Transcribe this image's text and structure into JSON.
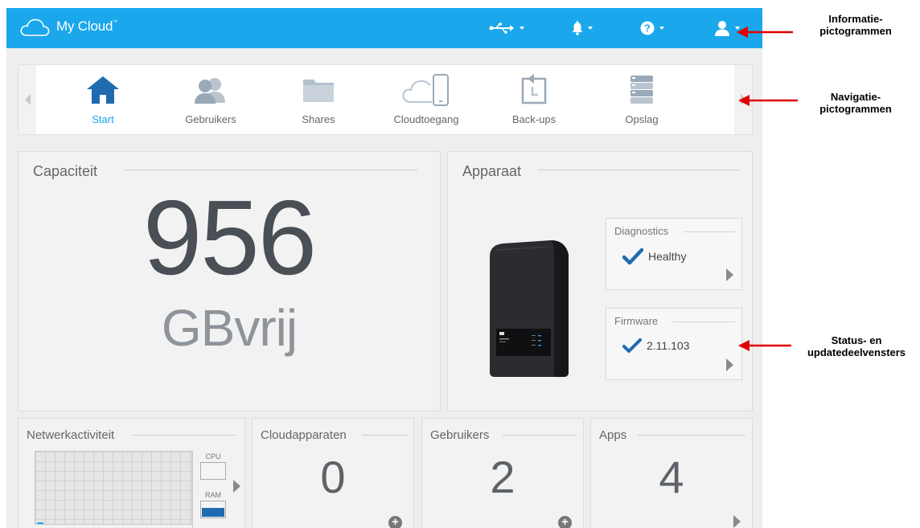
{
  "app": {
    "title": "My Cloud",
    "trademark": "™"
  },
  "topbar_icons": [
    {
      "name": "usb-icon"
    },
    {
      "name": "bell-icon"
    },
    {
      "name": "help-icon"
    },
    {
      "name": "user-icon"
    }
  ],
  "nav": {
    "items": [
      {
        "label": "Start",
        "icon": "home-icon",
        "active": true
      },
      {
        "label": "Gebruikers",
        "icon": "users-icon"
      },
      {
        "label": "Shares",
        "icon": "folder-icon"
      },
      {
        "label": "Cloudtoegang",
        "icon": "cloud-phone-icon"
      },
      {
        "label": "Back-ups",
        "icon": "backup-icon"
      },
      {
        "label": "Opslag",
        "icon": "storage-icon"
      }
    ]
  },
  "capacity": {
    "title": "Capaciteit",
    "value": "956",
    "unit": "GBvrij"
  },
  "device": {
    "title": "Apparaat",
    "diagnostics": {
      "title": "Diagnostics",
      "status": "Healthy"
    },
    "firmware": {
      "title": "Firmware",
      "version": "2.11.103"
    }
  },
  "network": {
    "title": "Netwerkactiviteit",
    "cpu_label": "CPU",
    "ram_label": "RAM",
    "cpu_level": 0,
    "ram_level": 0.55
  },
  "cloud_devices": {
    "title": "Cloudapparaten",
    "count": "0"
  },
  "users": {
    "title": "Gebruikers",
    "count": "2"
  },
  "apps": {
    "title": "Apps",
    "count": "4"
  },
  "annotations": {
    "info": "Informatie-\npictogrammen",
    "nav": "Navigatie-\npictogrammen",
    "status": "Status- en\nupdatedeelvensters"
  },
  "colors": {
    "accent": "#1aa7ec",
    "arrow": "#e00000",
    "check": "#1e6bb0"
  }
}
